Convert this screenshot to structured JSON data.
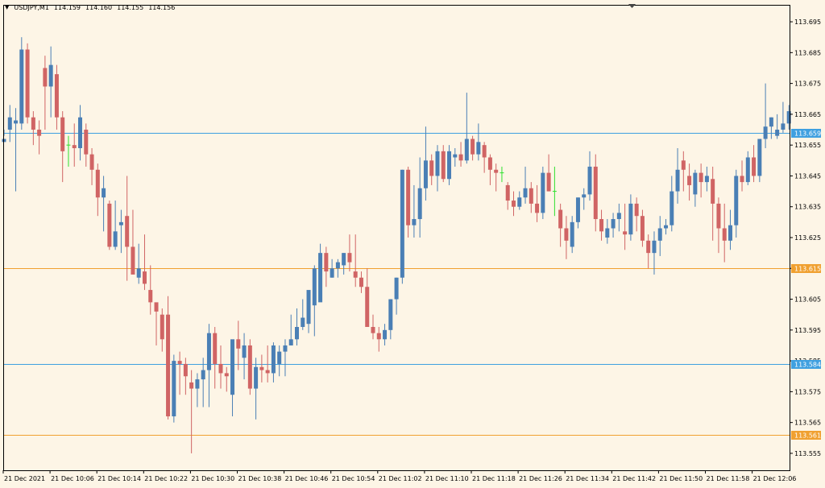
{
  "window": {
    "symbol": "USDJPY,M1",
    "quote_values": [
      "114.159",
      "114.160",
      "114.155",
      "114.156"
    ]
  },
  "colors": {
    "background": "#FDF5E6",
    "bull": "#4A7FB5",
    "bear": "#D06464",
    "doji": "#2EE02E",
    "blue_level": "#3FA0E0",
    "orange_level": "#F0A030",
    "axis": "#000000"
  },
  "chart_data": {
    "type": "candlestick",
    "symbol": "USDJPY,M1",
    "ylim": [
      113.5495,
      113.7005
    ],
    "y_ticks": [
      "113.695",
      "113.685",
      "113.675",
      "113.665",
      "113.655",
      "113.645",
      "113.635",
      "113.625",
      "113.615",
      "113.605",
      "113.595",
      "113.585",
      "113.575",
      "113.565",
      "113.555"
    ],
    "x_tick_labels": [
      "21 Dec 2021",
      "21 Dec 10:06",
      "21 Dec 10:14",
      "21 Dec 10:22",
      "21 Dec 10:30",
      "21 Dec 10:38",
      "21 Dec 10:46",
      "21 Dec 10:54",
      "21 Dec 11:02",
      "21 Dec 11:10",
      "21 Dec 11:18",
      "21 Dec 11:26",
      "21 Dec 11:34",
      "21 Dec 11:42",
      "21 Dec 11:50",
      "21 Dec 11:58",
      "21 Dec 12:06"
    ],
    "levels": [
      {
        "value": "113.659",
        "color": "blue"
      },
      {
        "value": "113.615",
        "color": "orange"
      },
      {
        "value": "113.584",
        "color": "blue"
      },
      {
        "value": "113.561",
        "color": "orange"
      }
    ],
    "candles": [
      [
        113.656,
        113.66,
        113.658,
        113.657
      ],
      [
        113.66,
        113.668,
        113.656,
        113.664
      ],
      [
        113.662,
        113.667,
        113.64,
        113.663
      ],
      [
        113.662,
        113.69,
        113.66,
        113.686
      ],
      [
        113.686,
        113.688,
        113.662,
        113.664
      ],
      [
        113.664,
        113.666,
        113.655,
        113.66
      ],
      [
        113.66,
        113.663,
        113.652,
        113.658
      ],
      [
        113.68,
        113.684,
        113.66,
        113.674
      ],
      [
        113.674,
        113.687,
        113.664,
        113.681
      ],
      [
        113.678,
        113.681,
        113.66,
        113.664
      ],
      [
        113.664,
        113.666,
        113.643,
        113.653
      ],
      [
        113.655,
        113.658,
        113.648,
        113.655
      ],
      [
        113.655,
        113.662,
        113.648,
        113.654
      ],
      [
        113.654,
        113.668,
        113.65,
        113.664
      ],
      [
        113.66,
        113.662,
        113.648,
        113.652
      ],
      [
        113.652,
        113.654,
        113.642,
        113.647
      ],
      [
        113.647,
        113.649,
        113.632,
        113.638
      ],
      [
        113.638,
        113.645,
        113.627,
        113.641
      ],
      [
        113.636,
        113.637,
        113.621,
        113.622
      ],
      [
        113.622,
        113.637,
        113.621,
        113.627
      ],
      [
        113.629,
        113.634,
        113.62,
        113.63
      ],
      [
        113.632,
        113.645,
        113.611,
        113.622
      ],
      [
        113.622,
        113.634,
        113.617,
        113.613
      ],
      [
        113.612,
        113.623,
        113.61,
        113.615
      ],
      [
        113.614,
        113.626,
        113.608,
        113.61
      ],
      [
        113.608,
        113.616,
        113.6,
        113.604
      ],
      [
        113.604,
        113.602,
        113.59,
        113.601
      ],
      [
        113.6,
        113.602,
        113.588,
        113.592
      ],
      [
        113.6,
        113.606,
        113.566,
        113.567
      ],
      [
        113.567,
        113.587,
        113.565,
        113.585
      ],
      [
        113.585,
        113.588,
        113.574,
        113.584
      ],
      [
        113.584,
        113.586,
        113.574,
        113.58
      ],
      [
        113.578,
        113.582,
        113.555,
        113.576
      ],
      [
        113.576,
        113.581,
        113.57,
        113.579
      ],
      [
        113.579,
        113.586,
        113.57,
        113.582
      ],
      [
        113.582,
        113.597,
        113.57,
        113.594
      ],
      [
        113.594,
        113.596,
        113.576,
        113.584
      ],
      [
        113.584,
        113.59,
        113.576,
        113.581
      ],
      [
        113.581,
        113.583,
        113.575,
        113.58
      ],
      [
        113.574,
        113.582,
        113.567,
        113.592
      ],
      [
        113.592,
        113.598,
        113.582,
        113.589
      ],
      [
        113.586,
        113.594,
        113.579,
        113.59
      ],
      [
        113.59,
        113.592,
        113.574,
        113.576
      ],
      [
        113.576,
        113.586,
        113.566,
        113.583
      ],
      [
        113.583,
        113.587,
        113.578,
        113.582
      ],
      [
        113.582,
        113.59,
        113.578,
        113.581
      ],
      [
        113.581,
        113.591,
        113.578,
        113.59
      ],
      [
        113.584,
        113.59,
        113.58,
        113.588
      ],
      [
        113.588,
        113.592,
        113.58,
        113.59
      ],
      [
        113.59,
        113.6,
        113.59,
        113.592
      ],
      [
        113.592,
        113.602,
        113.59,
        113.596
      ],
      [
        113.596,
        113.605,
        113.595,
        113.599
      ],
      [
        113.597,
        113.603,
        113.594,
        113.608
      ],
      [
        113.603,
        113.616,
        113.593,
        113.615
      ],
      [
        113.604,
        113.623,
        113.611,
        113.62
      ],
      [
        113.62,
        113.622,
        113.609,
        113.614
      ],
      [
        113.612,
        113.618,
        113.612,
        113.615
      ],
      [
        113.615,
        113.618,
        113.612,
        113.617
      ],
      [
        113.616,
        113.62,
        113.613,
        113.62
      ],
      [
        113.62,
        113.626,
        113.614,
        113.617
      ],
      [
        113.614,
        113.626,
        113.609,
        113.612
      ],
      [
        113.612,
        113.614,
        113.607,
        113.609
      ],
      [
        113.609,
        113.615,
        113.6,
        113.596
      ],
      [
        113.596,
        113.6,
        113.592,
        113.594
      ],
      [
        113.594,
        113.596,
        113.588,
        113.592
      ],
      [
        113.592,
        113.597,
        113.59,
        113.595
      ],
      [
        113.595,
        113.605,
        113.592,
        113.605
      ],
      [
        113.605,
        113.612,
        113.6,
        113.612
      ],
      [
        113.612,
        113.647,
        113.61,
        113.647
      ],
      [
        113.647,
        113.648,
        113.625,
        113.629
      ],
      [
        113.629,
        113.642,
        113.625,
        113.631
      ],
      [
        113.631,
        113.651,
        113.625,
        113.641
      ],
      [
        113.641,
        113.661,
        113.637,
        113.65
      ],
      [
        113.65,
        113.652,
        113.642,
        113.645
      ],
      [
        113.645,
        113.655,
        113.64,
        113.653
      ],
      [
        113.653,
        113.655,
        113.643,
        113.644
      ],
      [
        113.644,
        113.655,
        113.642,
        113.653
      ],
      [
        113.651,
        113.654,
        113.648,
        113.652
      ],
      [
        113.652,
        113.656,
        113.648,
        113.65
      ],
      [
        113.65,
        113.672,
        113.649,
        113.657
      ],
      [
        113.657,
        113.658,
        113.65,
        113.652
      ],
      [
        113.652,
        113.662,
        113.65,
        113.656
      ],
      [
        113.655,
        113.656,
        113.646,
        113.651
      ],
      [
        113.651,
        113.652,
        113.642,
        113.647
      ],
      [
        113.647,
        113.649,
        113.64,
        113.646
      ],
      [
        113.646,
        113.648,
        113.643,
        113.646
      ],
      [
        113.642,
        113.643,
        113.634,
        113.637
      ],
      [
        113.637,
        113.64,
        113.632,
        113.635
      ],
      [
        113.635,
        113.64,
        113.634,
        113.638
      ],
      [
        113.638,
        113.648,
        113.636,
        113.641
      ],
      [
        113.641,
        113.643,
        113.633,
        113.636
      ],
      [
        113.636,
        113.642,
        113.63,
        113.633
      ],
      [
        113.633,
        113.648,
        113.631,
        113.646
      ],
      [
        113.646,
        113.652,
        113.64,
        113.64
      ],
      [
        113.64,
        113.648,
        113.632,
        113.64
      ],
      [
        113.634,
        113.636,
        113.622,
        113.628
      ],
      [
        113.628,
        113.632,
        113.618,
        113.624
      ],
      [
        113.622,
        113.632,
        113.62,
        113.63
      ],
      [
        113.63,
        113.638,
        113.628,
        113.638
      ],
      [
        113.638,
        113.641,
        113.634,
        113.639
      ],
      [
        113.639,
        113.653,
        113.637,
        113.648
      ],
      [
        113.648,
        113.652,
        113.627,
        113.631
      ],
      [
        113.631,
        113.634,
        113.624,
        113.627
      ],
      [
        113.625,
        113.631,
        113.623,
        113.628
      ],
      [
        113.628,
        113.633,
        113.625,
        113.631
      ],
      [
        113.631,
        113.636,
        113.627,
        113.633
      ],
      [
        113.627,
        113.636,
        113.621,
        113.626
      ],
      [
        113.626,
        113.639,
        113.624,
        113.636
      ],
      [
        113.636,
        113.638,
        113.627,
        113.632
      ],
      [
        113.632,
        113.634,
        113.622,
        113.624
      ],
      [
        113.624,
        113.626,
        113.615,
        113.62
      ],
      [
        113.62,
        113.627,
        113.613,
        113.624
      ],
      [
        113.624,
        113.632,
        113.619,
        113.628
      ],
      [
        113.628,
        113.631,
        113.626,
        113.629
      ],
      [
        113.629,
        113.645,
        113.627,
        113.64
      ],
      [
        113.64,
        113.654,
        113.636,
        113.647
      ],
      [
        113.65,
        113.653,
        113.64,
        113.647
      ],
      [
        113.645,
        113.649,
        113.637,
        113.642
      ],
      [
        113.639,
        113.647,
        113.635,
        113.646
      ],
      [
        113.646,
        113.649,
        113.638,
        113.643
      ],
      [
        113.643,
        113.648,
        113.64,
        113.645
      ],
      [
        113.644,
        113.648,
        113.624,
        113.636
      ],
      [
        113.636,
        113.638,
        113.62,
        113.628
      ],
      [
        113.628,
        113.636,
        113.617,
        113.624
      ],
      [
        113.624,
        113.634,
        113.621,
        113.629
      ],
      [
        113.629,
        113.647,
        113.625,
        113.645
      ],
      [
        113.645,
        113.65,
        113.64,
        113.643
      ],
      [
        113.643,
        113.653,
        113.642,
        113.651
      ],
      [
        113.651,
        113.655,
        113.643,
        113.645
      ],
      [
        113.645,
        113.656,
        113.643,
        113.657
      ],
      [
        113.657,
        113.675,
        113.654,
        113.661
      ],
      [
        113.661,
        113.664,
        113.657,
        113.664
      ],
      [
        113.658,
        113.665,
        113.657,
        113.66
      ],
      [
        113.66,
        113.669,
        113.659,
        113.662
      ],
      [
        113.662,
        113.668,
        113.66,
        113.666
      ]
    ]
  }
}
